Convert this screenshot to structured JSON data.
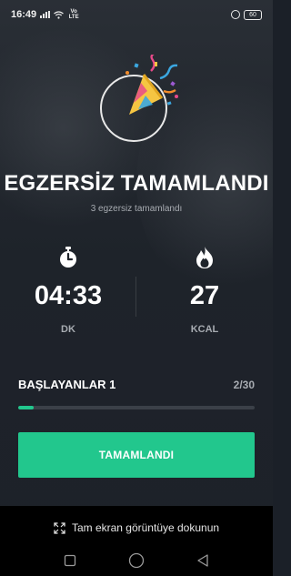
{
  "status_bar": {
    "time": "16:49",
    "network_label": "Vo LTE",
    "battery": "60"
  },
  "workout_summary": {
    "title": "EGZERSİZ TAMAMLANDI",
    "subtitle": "3 egzersiz tamamlandı",
    "duration": {
      "value": "04:33",
      "unit": "DK",
      "icon": "stopwatch-icon"
    },
    "calories": {
      "value": "27",
      "unit": "KCAL",
      "icon": "flame-icon"
    }
  },
  "program": {
    "name": "BAŞLAYANLAR 1",
    "progress_text": "2/30",
    "progress_fraction": 0.0667
  },
  "done_button": {
    "label": "TAMAMLANDI"
  },
  "fullscreen_hint": {
    "text": "Tam ekran görüntüye dokunun",
    "icon": "expand-icon"
  },
  "nav_bar": {
    "icons": [
      "recents-square-icon",
      "home-circle-icon",
      "back-triangle-icon"
    ]
  },
  "colors": {
    "accent": "#22c78d",
    "background": "#1d2129",
    "secondary_text": "#a7abb1"
  }
}
